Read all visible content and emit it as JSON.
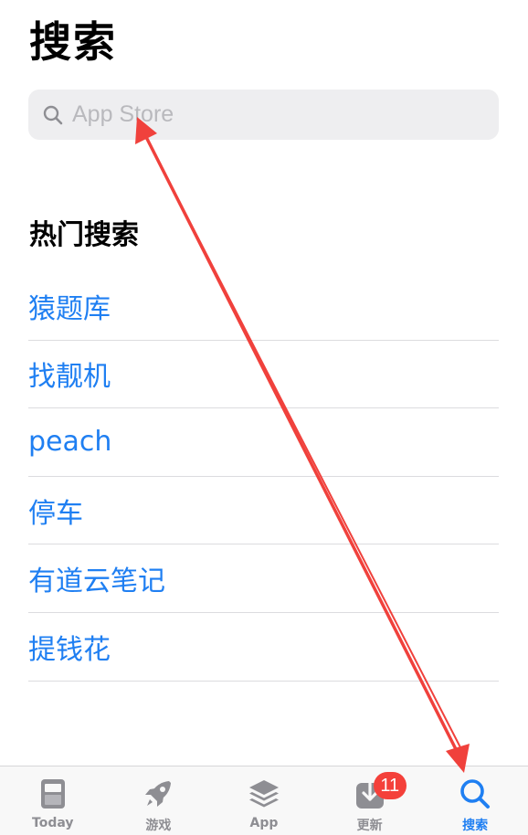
{
  "header": {
    "title": "搜索"
  },
  "search": {
    "placeholder": "App Store"
  },
  "trending": {
    "title": "热门搜索",
    "items": [
      {
        "label": "猿题库"
      },
      {
        "label": "找靓机"
      },
      {
        "label": "peach"
      },
      {
        "label": "停车"
      },
      {
        "label": "有道云笔记"
      },
      {
        "label": "提钱花"
      }
    ]
  },
  "tabbar": {
    "tabs": [
      {
        "label": "Today",
        "icon": "today-icon"
      },
      {
        "label": "游戏",
        "icon": "rocket-icon"
      },
      {
        "label": "App",
        "icon": "layers-icon"
      },
      {
        "label": "更新",
        "icon": "download-icon",
        "badge": "11"
      },
      {
        "label": "搜索",
        "icon": "search-icon",
        "active": true
      }
    ]
  },
  "colors": {
    "accent": "#1f7ff2",
    "badge": "#f4403a",
    "annotation_arrow": "#f0413c"
  }
}
